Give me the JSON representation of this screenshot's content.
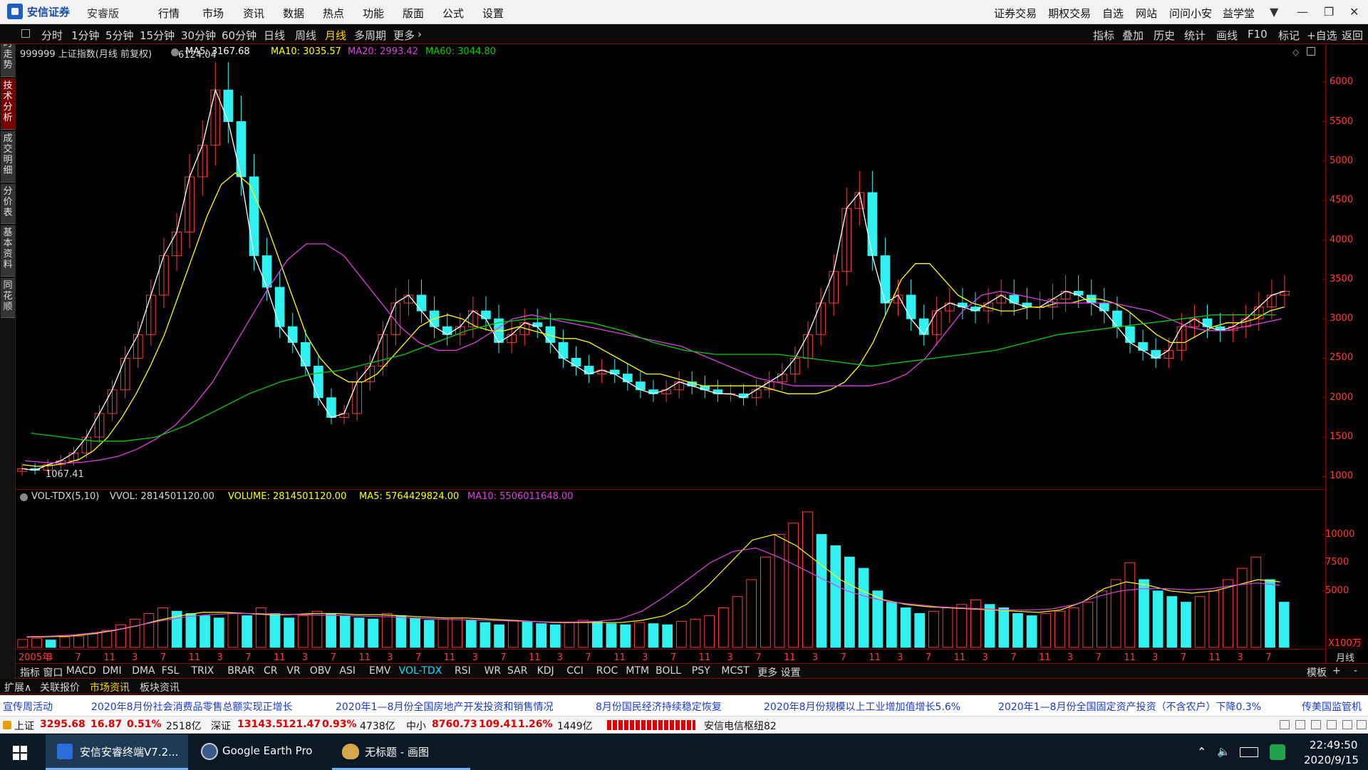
{
  "titlebar": {
    "brand": "安信证券",
    "edition": "安睿版",
    "menu": [
      "行情",
      "市场",
      "资讯",
      "数据",
      "热点",
      "功能",
      "版面",
      "公式",
      "设置"
    ],
    "right_menu": [
      "证券交易",
      "期权交易",
      "自选",
      "网站",
      "问问小安",
      "益学堂"
    ]
  },
  "toolbar": {
    "periods": [
      "分时",
      "1分钟",
      "5分钟",
      "15分钟",
      "30分钟",
      "60分钟",
      "日线",
      "周线",
      "月线",
      "多周期",
      "更多"
    ],
    "active_period": "月线",
    "right_tools": [
      "指标",
      "叠加",
      "历史",
      "统计",
      "画线",
      "F10",
      "标记",
      "+自选",
      "返回"
    ]
  },
  "left_tabs": [
    {
      "label": "分时走势",
      "active": false
    },
    {
      "label": "技术分析",
      "active": true
    },
    {
      "label": "成交明细",
      "active": false
    },
    {
      "label": "分价表",
      "active": false
    },
    {
      "label": "基本资料",
      "active": false
    },
    {
      "label": "同花顺",
      "active": false
    }
  ],
  "main_header": {
    "title": "999999 上证指数(月线 前复权)",
    "ma5": "MA5: 3167.68",
    "ma10": "MA10: 3035.57",
    "ma20": "MA20: 2993.42",
    "ma60": "MA60: 3044.80",
    "high_label": "6124.04",
    "low_label": "1067.41"
  },
  "vol_header": {
    "title": "VOL-TDX(5,10)",
    "vvol": "VVOL: 2814501120.00",
    "volume": "VOLUME: 2814501120.00",
    "ma5": "MA5: 5764429824.00",
    "ma10": "MA10: 5506011648.00",
    "unit": "X100万"
  },
  "colors": {
    "up": "#ff3b3b",
    "down": "#30f0f0",
    "ma5": "#ffffff",
    "ma10": "#ffff00",
    "ma20": "#e040e0",
    "ma60": "#00d000",
    "axis": "#8b0000",
    "price_tick": "#ff3b3b"
  },
  "chart_data": {
    "type": "candlestick",
    "series_name": "999999 上证指数(月线 前复权)",
    "y_ticks": [
      1000,
      1500,
      2000,
      2500,
      3000,
      3500,
      4000,
      4500,
      5000,
      5500,
      6000
    ],
    "vol_y_ticks": [
      5000,
      7500,
      10000
    ],
    "x_labels": [
      "2005年",
      "3",
      "7",
      "11",
      "3",
      "7",
      "11",
      "3",
      "7",
      "11",
      "3",
      "7",
      "11",
      "3",
      "7",
      "11",
      "3",
      "7",
      "11",
      "3",
      "7",
      "11",
      "3",
      "7",
      "11",
      "3",
      "7",
      "11",
      "3",
      "7",
      "11",
      "3",
      "7",
      "11",
      "3",
      "7",
      "11",
      "3",
      "7",
      "11",
      "3",
      "7",
      "11",
      "3",
      "7"
    ],
    "period_label": "月线",
    "close_points": [
      1100,
      1080,
      1150,
      1200,
      1300,
      1500,
      1800,
      2100,
      2500,
      2800,
      3300,
      3800,
      4100,
      4800,
      5200,
      5900,
      5500,
      4800,
      3800,
      3400,
      2900,
      2700,
      2400,
      2000,
      1750,
      1800,
      2200,
      2400,
      2800,
      3200,
      3300,
      3100,
      2900,
      2800,
      2900,
      3100,
      3000,
      2700,
      2800,
      2950,
      2900,
      2700,
      2500,
      2400,
      2300,
      2350,
      2300,
      2200,
      2100,
      2050,
      2100,
      2200,
      2150,
      2100,
      2050,
      2050,
      2000,
      2100,
      2200,
      2300,
      2500,
      2800,
      3200,
      3600,
      4400,
      4600,
      3800,
      3200,
      3300,
      3000,
      2800,
      3100,
      3200,
      3150,
      3100,
      3200,
      3300,
      3200,
      3150,
      3150,
      3250,
      3350,
      3300,
      3200,
      3100,
      2900,
      2700,
      2600,
      2500,
      2600,
      2900,
      3000,
      2900,
      2850,
      2900,
      3000,
      3150,
      3300,
      3350
    ],
    "ma10_points": [
      1150,
      1130,
      1140,
      1170,
      1220,
      1330,
      1500,
      1750,
      2050,
      2400,
      2800,
      3300,
      3800,
      4300,
      4700,
      4850,
      4700,
      4300,
      3800,
      3300,
      2800,
      2500,
      2300,
      2200,
      2200,
      2300,
      2500,
      2700,
      2900,
      3000,
      3050,
      3000,
      2900,
      2850,
      2850,
      2900,
      2850,
      2800,
      2750,
      2750,
      2700,
      2600,
      2500,
      2400,
      2300,
      2300,
      2250,
      2200,
      2150,
      2150,
      2150,
      2150,
      2150,
      2100,
      2050,
      2050,
      2050,
      2100,
      2200,
      2400,
      2700,
      3100,
      3500,
      3700,
      3700,
      3500,
      3300,
      3200,
      3150,
      3100,
      3100,
      3150,
      3150,
      3200,
      3200,
      3250,
      3250,
      3200,
      3100,
      2950,
      2800,
      2700,
      2700,
      2800,
      2900,
      2950,
      2950,
      3000,
      3100,
      3150
    ],
    "ma20_points": [
      1200,
      1180,
      1170,
      1180,
      1210,
      1260,
      1350,
      1480,
      1650,
      1900,
      2200,
      2600,
      3000,
      3400,
      3750,
      3950,
      3950,
      3800,
      3500,
      3200,
      2900,
      2700,
      2600,
      2600,
      2700,
      2850,
      3000,
      3050,
      3000,
      2950,
      2900,
      2850,
      2800,
      2750,
      2700,
      2650,
      2550,
      2450,
      2350,
      2250,
      2200,
      2150,
      2150,
      2150,
      2150,
      2150,
      2200,
      2300,
      2500,
      2800,
      3100,
      3300,
      3350,
      3300,
      3250,
      3200,
      3200,
      3200,
      3200,
      3150,
      3100,
      3000,
      2900,
      2850,
      2850,
      2900,
      2950,
      3000
    ],
    "ma60_points": [
      1550,
      1500,
      1450,
      1450,
      1500,
      1650,
      1850,
      2050,
      2200,
      2300,
      2350,
      2450,
      2550,
      2700,
      2850,
      2950,
      3000,
      3000,
      2950,
      2850,
      2700,
      2600,
      2550,
      2550,
      2550,
      2500,
      2450,
      2400,
      2450,
      2500,
      2550,
      2600,
      2700,
      2800,
      2850,
      2900,
      2950,
      3000,
      3050,
      3050,
      3050
    ],
    "volume_bars": [
      700,
      800,
      650,
      900,
      1000,
      1200,
      1500,
      2000,
      2500,
      3000,
      3500,
      3200,
      3000,
      2800,
      2600,
      3000,
      2800,
      3500,
      3000,
      2600,
      2800,
      3200,
      3000,
      2800,
      2600,
      2500,
      3000,
      2800,
      2600,
      2400,
      2500,
      2600,
      2400,
      2200,
      2000,
      2400,
      2300,
      2100,
      2000,
      2200,
      2400,
      2300,
      2100,
      2000,
      2200,
      2100,
      2000,
      2300,
      2500,
      2800,
      3500,
      4500,
      6000,
      8000,
      10000,
      11000,
      12000,
      10000,
      9000,
      8000,
      7000,
      5000,
      4000,
      3500,
      3000,
      3200,
      3500,
      3800,
      4200,
      3800,
      3500,
      3000,
      2800,
      3000,
      3200,
      3500,
      4000,
      5000,
      6000,
      7500,
      6000,
      5000,
      4500,
      4000,
      4500,
      5000,
      6000,
      7000,
      8000,
      6000,
      4000
    ],
    "vol_ma5": [
      900,
      950,
      1000,
      1200,
      1500,
      1900,
      2400,
      2800,
      3100,
      3100,
      3000,
      2900,
      2900,
      3000,
      3000,
      2900,
      2900,
      2800,
      2700,
      2600,
      2600,
      2500,
      2400,
      2300,
      2200,
      2200,
      2200,
      2200,
      2400,
      2800,
      3800,
      5500,
      7500,
      9500,
      10000,
      9000,
      7500,
      6000,
      5000,
      4200,
      3800,
      3600,
      3500,
      3400,
      3300,
      3200,
      3100,
      3300,
      4000,
      5200,
      5800,
      5500,
      5000,
      4800,
      5000,
      5500,
      6000,
      5800
    ],
    "vol_ma10": [
      950,
      1000,
      1100,
      1300,
      1600,
      2000,
      2400,
      2700,
      2900,
      3000,
      3000,
      2950,
      2900,
      2850,
      2800,
      2750,
      2700,
      2600,
      2500,
      2450,
      2400,
      2350,
      2300,
      2250,
      2250,
      2300,
      2500,
      3200,
      4500,
      6000,
      7500,
      8500,
      8800,
      8000,
      7000,
      6000,
      5000,
      4400,
      4000,
      3800,
      3600,
      3500,
      3400,
      3300,
      3300,
      3400,
      3800,
      4500,
      5000,
      5200,
      5200,
      5100,
      5200,
      5500,
      5700,
      5500
    ]
  },
  "indicator_tabs": {
    "items": [
      "指标",
      "窗口",
      "MACD",
      "DMI",
      "DMA",
      "FSL",
      "TRIX",
      "BRAR",
      "CR",
      "VR",
      "OBV",
      "ASI",
      "EMV",
      "VOL-TDX",
      "RSI",
      "WR",
      "SAR",
      "KDJ",
      "CCI",
      "ROC",
      "MTM",
      "BOLL",
      "PSY",
      "MCST",
      "更多",
      "设置"
    ],
    "active": "VOL-TDX",
    "right": [
      "模板",
      "+",
      "-"
    ]
  },
  "info_tabs": {
    "items": [
      "扩展∧",
      "关联报价",
      "市场资讯",
      "板块资讯"
    ],
    "active": "市场资讯"
  },
  "news": [
    "宣传周活动",
    "2020年8月份社会消费品零售总额实现正增长",
    "2020年1—8月份全国房地产开发投资和销售情况",
    "8月份国民经济持续稳定恢复",
    "2020年8月份规模以上工业增加值增长5.6%",
    "2020年1—8月份全国固定资产投资（不含农户）下降0.3%",
    "传美国监管机"
  ],
  "status": {
    "sh_label": "上证",
    "sh_value": "3295.68",
    "sh_change": "16.87",
    "sh_pct": "0.51%",
    "sh_amount": "2518亿",
    "sz_label": "深证",
    "sz_value": "13143.5",
    "sz_change": "121.47",
    "sz_pct": "0.93%",
    "sz_amount": "4738亿",
    "zx_label": "中小",
    "zx_value": "8760.73",
    "zx_change": "109.41",
    "zx_pct": "1.26%",
    "zx_amount": "1449亿",
    "server": "安信电信枢纽82"
  },
  "taskbar": {
    "apps": [
      "安信安睿终端V7.2...",
      "Google Earth Pro",
      "无标题 - 画图"
    ],
    "time": "22:49:50",
    "date": "2020/9/15"
  }
}
